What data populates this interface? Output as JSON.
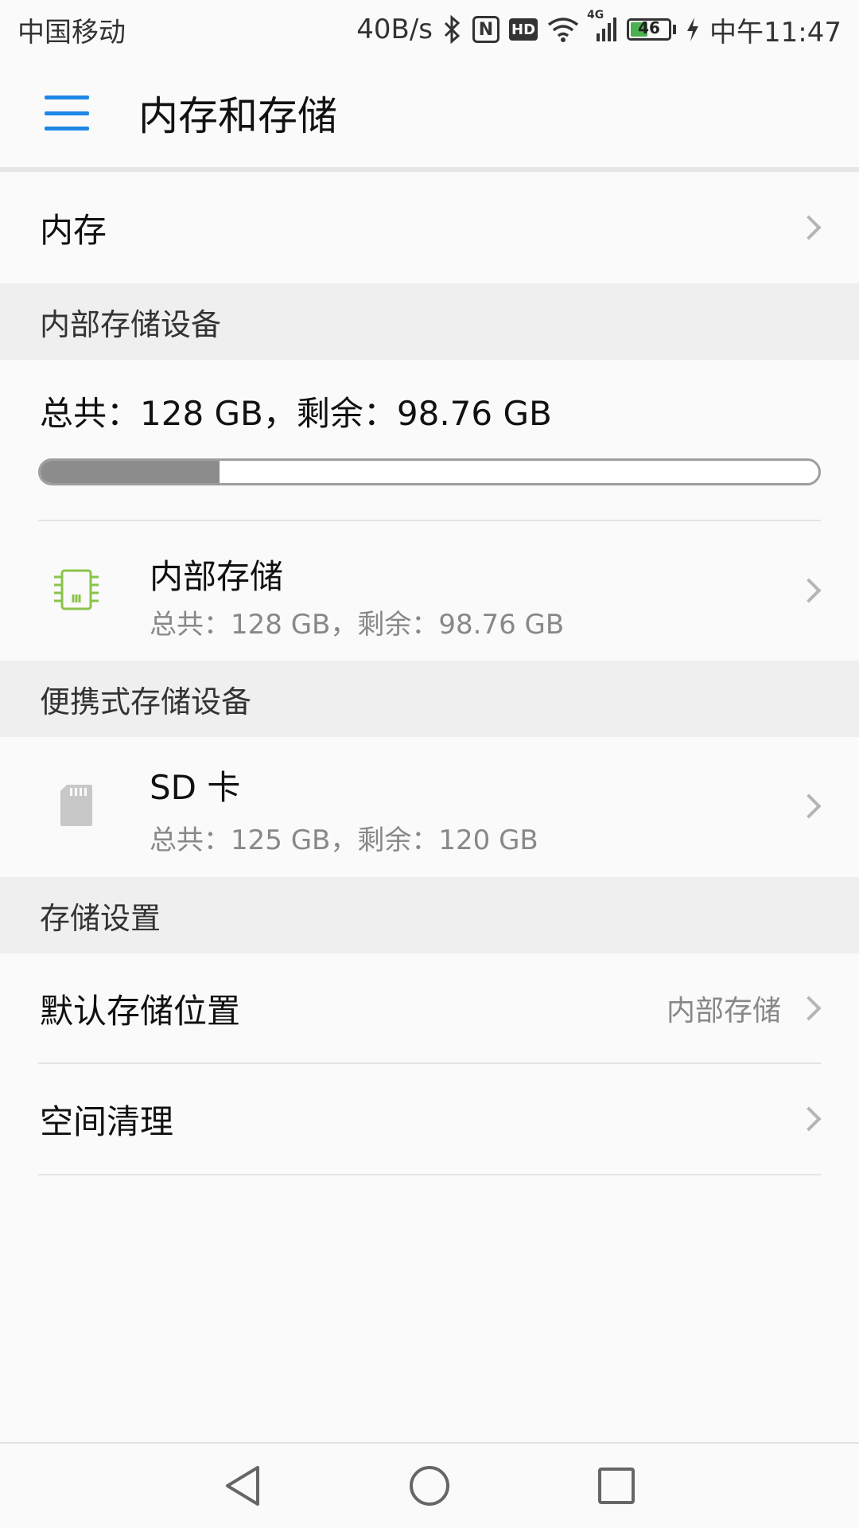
{
  "status_bar": {
    "carrier": "中国移动",
    "net_speed": "40B/s",
    "nfc": "N",
    "hd": "HD",
    "net_type": "4G",
    "battery": "46",
    "time": "中午11:47"
  },
  "app_bar": {
    "title": "内存和存储"
  },
  "memory_row": {
    "label": "内存"
  },
  "internal_section": {
    "header": "内部存储设备",
    "summary": "总共：128 GB，剩余：98.76 GB",
    "used_fraction": 0.23,
    "item": {
      "title": "内部存储",
      "subtitle": "总共：128 GB，剩余：98.76 GB"
    }
  },
  "portable_section": {
    "header": "便携式存储设备",
    "item": {
      "title": "SD 卡",
      "subtitle": "总共：125 GB，剩余：120 GB"
    }
  },
  "settings_section": {
    "header": "存储设置",
    "default_location": {
      "label": "默认存储位置",
      "value": "内部存储"
    },
    "cleanup": {
      "label": "空间清理"
    }
  },
  "colors": {
    "accent": "#1e88e5",
    "chip_icon": "#8bc34a",
    "progress_fill": "#8c8c8c",
    "battery": "#4caf50"
  }
}
